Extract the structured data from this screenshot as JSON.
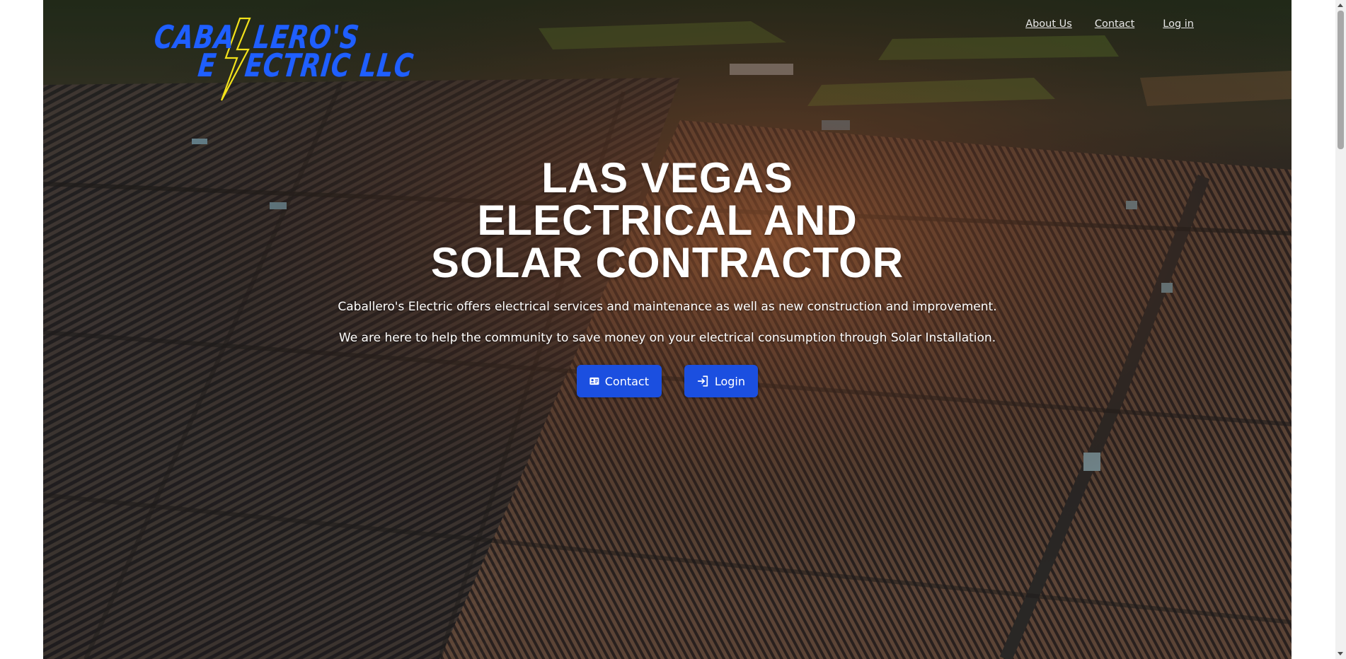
{
  "brand": {
    "logo_line1": "CABA  LERO'S",
    "logo_line2": "E   ECTRIC LLC",
    "logo_color": "#1f5fff",
    "bolt_color": "#f2e21a"
  },
  "nav": {
    "items": [
      {
        "label": "About Us"
      },
      {
        "label": "Contact"
      },
      {
        "label": "Log in"
      }
    ]
  },
  "hero": {
    "headline": [
      "LAS VEGAS",
      "ELECTRICAL AND",
      "SOLAR CONTRACTOR"
    ],
    "description1": "Caballero's Electric offers electrical services and maintenance as well as new construction and improvement.",
    "description2": "We are here to help the community to save money on your electrical consumption through Solar Installation.",
    "background": "aerial-solar-farm-photo"
  },
  "cta": {
    "contact_label": "Contact",
    "contact_icon": "contact-card-icon",
    "login_label": "Login",
    "login_icon": "login-arrow-icon",
    "button_color": "#1b4fe0"
  }
}
